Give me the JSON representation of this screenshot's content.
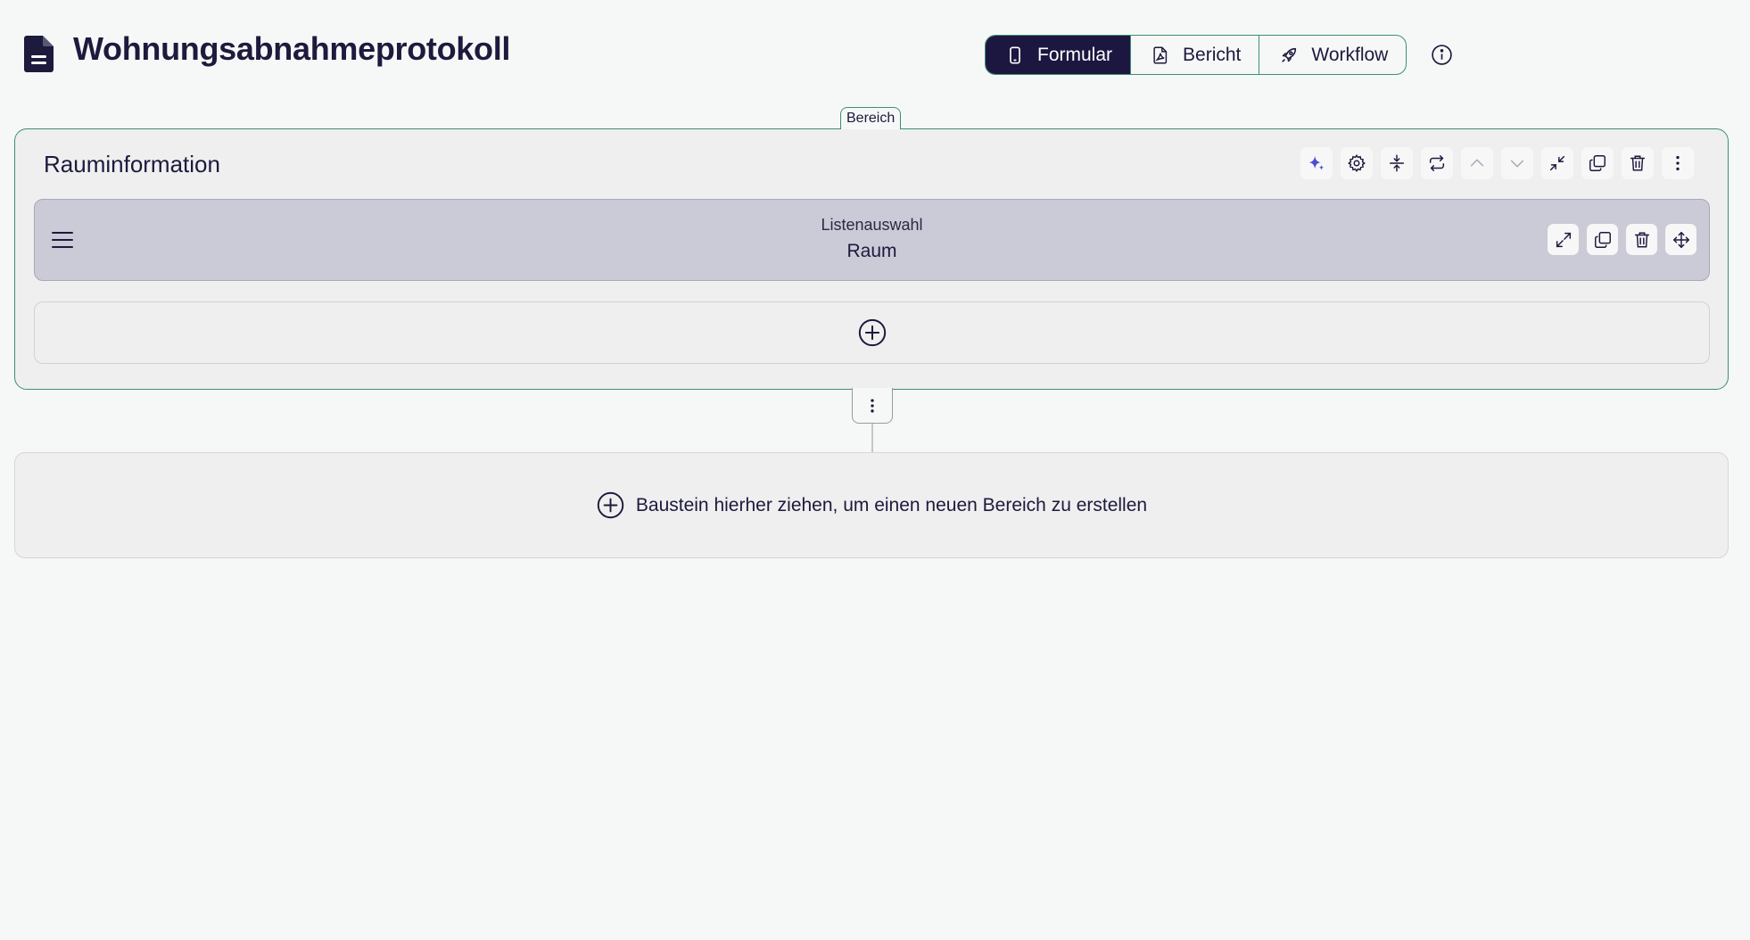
{
  "header": {
    "title": "Wohnungsabnahmeprotokoll",
    "icon": "document-icon",
    "tabs": [
      {
        "label": "Formular",
        "icon": "phone-icon",
        "active": true
      },
      {
        "label": "Bericht",
        "icon": "pdf-file-icon",
        "active": false
      },
      {
        "label": "Workflow",
        "icon": "rocket-icon",
        "active": false
      }
    ],
    "info_icon": "info-icon"
  },
  "section": {
    "tag": "Bereich",
    "title": "Rauminformation",
    "toolbar": [
      "sparkle-icon",
      "gear-icon",
      "collapse-vertical-icon",
      "repeat-icon",
      "chevron-up-icon",
      "chevron-down-icon",
      "minimize-icon",
      "copy-icon",
      "trash-icon",
      "more-vertical-icon"
    ],
    "field": {
      "type": "Listenauswahl",
      "label": "Raum",
      "tools": [
        "expand-icon",
        "copy-icon",
        "trash-icon",
        "move-icon"
      ]
    }
  },
  "dropzone": {
    "text": "Baustein hierher ziehen, um einen neuen Bereich zu erstellen"
  },
  "colors": {
    "accent_green": "#3d8f6f",
    "active_tab": "#1c1740",
    "field_bg": "#cbcad7",
    "text": "#1c1a3d",
    "sparkle": "#4b4bd8"
  }
}
